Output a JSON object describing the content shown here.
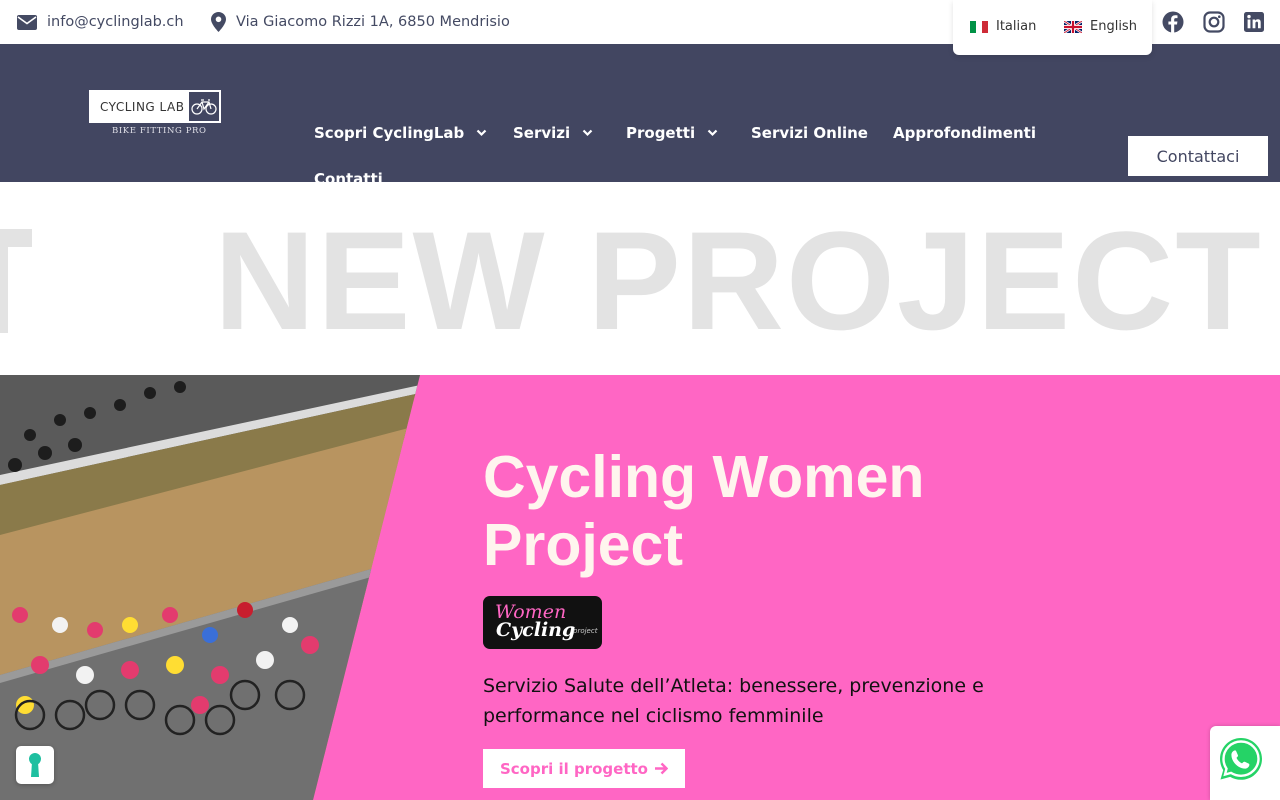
{
  "topbar": {
    "email": "info@cyclinglab.ch",
    "address": "Via Giacomo Rizzi 1A, 6850 Mendrisio",
    "languages": [
      {
        "label": "Italian",
        "flag": "italy-flag-icon"
      },
      {
        "label": "English",
        "flag": "uk-flag-icon"
      }
    ],
    "social": [
      "facebook-icon",
      "instagram-icon",
      "linkedin-icon"
    ]
  },
  "header": {
    "logo": {
      "text": "CYCLING LAB",
      "subtitle": "BIKE FITTING PRO"
    },
    "nav": [
      {
        "label": "Scopri CyclingLab",
        "dropdown": true
      },
      {
        "label": "Servizi",
        "dropdown": true
      },
      {
        "label": "Progetti",
        "dropdown": true
      },
      {
        "label": "Servizi Online",
        "dropdown": false
      },
      {
        "label": "Approfondimenti",
        "dropdown": false
      },
      {
        "label": "Contatti",
        "dropdown": false
      }
    ],
    "cta_label": "Contattaci"
  },
  "marquee": {
    "text": "NEW PROJECT"
  },
  "hero": {
    "title": "Cycling Women Project",
    "badge": {
      "line1": "Women",
      "line2": "Cycling",
      "line3": "project"
    },
    "subtitle": "Servizio Salute dell’Atleta: benessere, prevenzione e performance nel ciclismo femminile",
    "button_label": "Scopri il progetto"
  },
  "colors": {
    "header_bg": "#424661",
    "hero_bg": "#ff66c4",
    "marquee_text": "#e3e3e3",
    "whatsapp": "#25d366"
  }
}
